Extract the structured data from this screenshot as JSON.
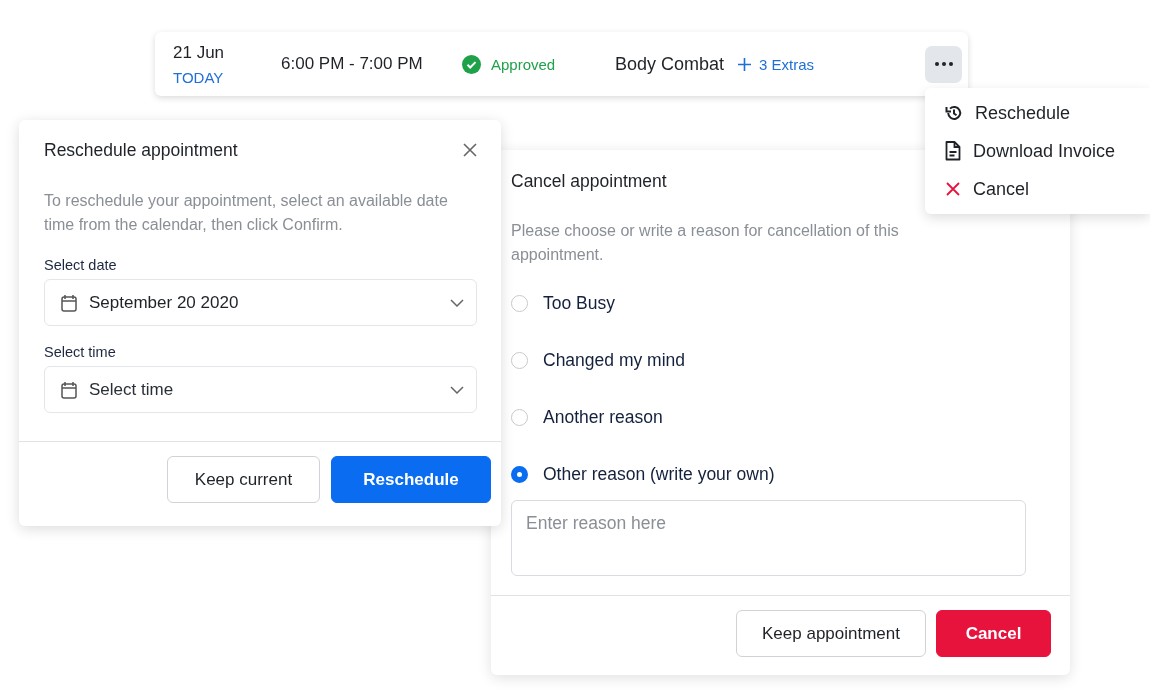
{
  "appointment": {
    "date": "21 Jun",
    "day_label": "TODAY",
    "time": "6:00 PM - 7:00 PM",
    "status": {
      "label": "Approved",
      "kind": "approved"
    },
    "class_name": "Body Combat",
    "extras": "3 Extras"
  },
  "menu": {
    "items": [
      {
        "label": "Reschedule",
        "kind": "reschedule"
      },
      {
        "label": "Download Invoice",
        "kind": "invoice"
      },
      {
        "label": "Cancel",
        "kind": "cancel"
      }
    ]
  },
  "reschedule_dialog": {
    "title": "Reschedule appointment",
    "description": "To reschedule your appointment, select an available date time from the calendar, then click Confirm.",
    "fields": [
      {
        "label": "Select date",
        "value": "September 20 2020"
      },
      {
        "label": "Select time",
        "placeholder": "Select time"
      }
    ],
    "buttons": [
      {
        "label": "Keep current",
        "kind": "secondary"
      },
      {
        "label": "Reschedule",
        "kind": "primary"
      }
    ]
  },
  "cancel_dialog": {
    "title": "Cancel appointment",
    "description": "Please choose or write a reason for cancellation of this appointment.",
    "reasons": [
      {
        "label": "Too Busy",
        "selected": false
      },
      {
        "label": "Changed my mind",
        "selected": false
      },
      {
        "label": "Another reason",
        "selected": false
      },
      {
        "label": "Other reason (write your own)",
        "selected": true
      }
    ],
    "reason_field": {
      "placeholder": "Enter reason here"
    },
    "buttons": [
      {
        "label": "Keep appointment",
        "kind": "secondary"
      },
      {
        "label": "Cancel",
        "kind": "danger"
      }
    ]
  }
}
